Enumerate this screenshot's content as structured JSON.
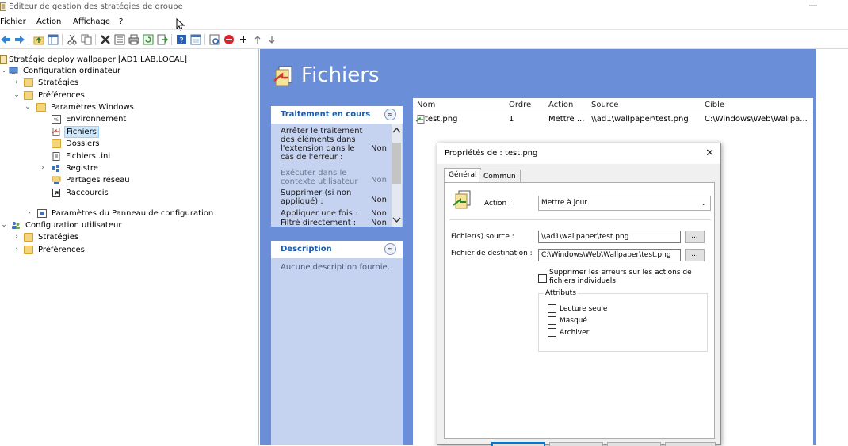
{
  "window": {
    "title": "Éditeur de gestion des stratégies de groupe",
    "minimize_symbol": "—"
  },
  "menu": [
    "Fichier",
    "Action",
    "Affichage",
    "?"
  ],
  "toolbar_icons": [
    "back-arrow-icon",
    "forward-arrow-icon",
    "folder-up-icon",
    "show-tree-icon",
    "cut-icon",
    "copy-icon",
    "delete-icon",
    "properties-icon",
    "print-icon",
    "refresh-icon",
    "export-icon",
    "help-icon",
    "view-icon",
    "properties-sheet-icon",
    "block-icon",
    "add-icon",
    "move-up-icon",
    "move-down-icon"
  ],
  "tree": {
    "root": "Stratégie deploy wallpaper [AD1.LAB.LOCAL]",
    "computer_config": "Configuration ordinateur",
    "cc_strategies": "Stratégies",
    "cc_preferences": "Préférences",
    "windows_settings": "Paramètres Windows",
    "environment": "Environnement",
    "files": "Fichiers",
    "folders": "Dossiers",
    "ini_files": "Fichiers .ini",
    "registry": "Registre",
    "network_shares": "Partages réseau",
    "shortcuts": "Raccourcis",
    "control_panel": "Paramètres du Panneau de configuration",
    "user_config": "Configuration utilisateur",
    "uc_strategies": "Stratégies",
    "uc_preferences": "Préférences",
    "expanded_glyph": "⌄",
    "collapsed_glyph": "›"
  },
  "header": {
    "title": "Fichiers"
  },
  "processing_panel": {
    "title": "Traitement en cours",
    "collapse_glyph": "≈",
    "row1_label": "Arrêter le traitement des éléments dans l'extension dans le cas de l'erreur :",
    "row1_value": "Non",
    "row2_label": "Exécuter dans le contexte utilisateur :",
    "row2_value": "Non",
    "row3_label": "Supprimer (si non appliqué) :",
    "row3_value": "Non",
    "row4_label": "Appliquer une fois :",
    "row4_value": "Non",
    "row5_label": "Filtré directement :",
    "row5_value": "Non"
  },
  "description_panel": {
    "title": "Description",
    "collapse_glyph": "≈",
    "text": "Aucune description fournie."
  },
  "list": {
    "columns": [
      "Nom",
      "Ordre",
      "Action",
      "Source",
      "Cible"
    ],
    "rows": [
      {
        "name": "test.png",
        "order": "1",
        "action": "Mettre ...",
        "source": "\\\\ad1\\wallpaper\\test.png",
        "target": "C:\\Windows\\Web\\Wallpa..."
      }
    ]
  },
  "dialog": {
    "title": "Propriétés de : test.png",
    "close_glyph": "✕",
    "tabs": [
      "Général",
      "Commun"
    ],
    "action_label": "Action :",
    "action_value": "Mettre à jour",
    "source_label": "Fichier(s) source :",
    "source_value": "\\\\ad1\\wallpaper\\test.png",
    "dest_label": "Fichier de destination :",
    "dest_value": "C:\\Windows\\Web\\Wallpaper\\test.png",
    "browse_label": "...",
    "suppress_errors_label": "Supprimer les erreurs sur les actions de fichiers individuels",
    "attributes_label": "Attributs",
    "readonly_label": "Lecture seule",
    "hidden_label": "Masqué",
    "archive_label": "Archiver"
  }
}
